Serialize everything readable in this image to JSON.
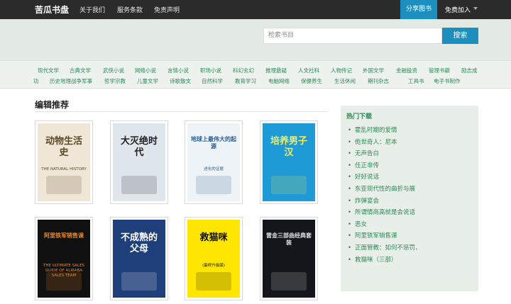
{
  "header": {
    "brand": "苦瓜书盘",
    "nav": [
      "关于我们",
      "服务条款",
      "免责声明"
    ],
    "share_label": "分享图书",
    "join_label": "免费加入"
  },
  "search": {
    "placeholder": "检索书目",
    "button_label": "搜索"
  },
  "categories": [
    "现代文学",
    "古典文学",
    "武侠小说",
    "网络小说",
    "言情小说",
    "职场小说",
    "科幻玄幻",
    "推理悬疑",
    "人文社科",
    "人物传记",
    "外国文学",
    "金融投资",
    "管理书籍",
    "励志成功",
    "历史地理",
    "战争军事",
    "哲学宗教",
    "儿童文学",
    "诗歌散文",
    "自然科学",
    "教育学习",
    "电脑网络",
    "保健养生",
    "生活休闲",
    "期刊杂志",
    "工具书",
    "电子书制作"
  ],
  "editor_picks": {
    "title": "编辑推荐",
    "books": [
      {
        "cover_text": "动物生活史",
        "cover_sub": "THE NATURAL HISTORY",
        "bg": "#efe6d6",
        "fg": "#5a4a2a"
      },
      {
        "cover_text": "大灭绝时代",
        "cover_sub": "",
        "bg": "#dfe6ec",
        "fg": "#222"
      },
      {
        "cover_text": "地球上最伟大的起源",
        "cover_sub": "进化的证据",
        "bg": "#eef3f7",
        "fg": "#2a5f8f"
      },
      {
        "cover_text": "培养男子汉",
        "cover_sub": "",
        "bg": "#1e9ad6",
        "fg": "#ffe94d"
      },
      {
        "cover_text": "阿里铁军销售课",
        "cover_sub": "THE ULTIMATE SALES GUIDE OF ALIBABA SALES TEAM",
        "bg": "#111",
        "fg": "#e5862b"
      },
      {
        "cover_text": "不成熟的父母",
        "cover_sub": "",
        "bg": "#1f3f7a",
        "fg": "#fff"
      },
      {
        "cover_text": "救猫咪",
        "cover_sub": "(最终升级版)",
        "bg": "#ffe600",
        "fg": "#111"
      },
      {
        "cover_text": "雷金三部曲经典套装",
        "cover_sub": "",
        "bg": "#14161c",
        "fg": "#ddd"
      }
    ]
  },
  "hot_downloads": {
    "title": "热门下载",
    "items": [
      "霍乱时期的爱情",
      "佹世奇人：尼本",
      "无声告白",
      "任正非传",
      "好好说话",
      "东亚现代性的曲折与展",
      "炸弹宴会",
      "所谓情商高就是会说话",
      "恶女",
      "阿里铁军销售课",
      "正面管教：如何不惩罚、",
      "救猫咪（三部）"
    ]
  },
  "colors": {
    "accent": "#1d8fbf",
    "link": "#2c8a56",
    "topbar": "#2b2b2b"
  }
}
